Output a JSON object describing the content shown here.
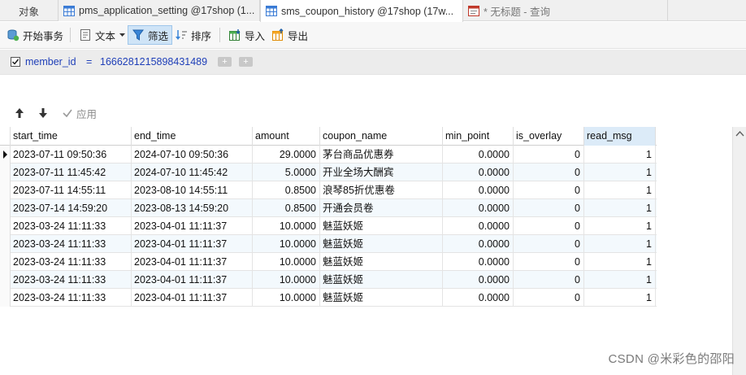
{
  "tabs": {
    "objects_label": "对象",
    "items": [
      {
        "label": "pms_application_setting @17shop (1..."
      },
      {
        "label": "sms_coupon_history @17shop (17w..."
      },
      {
        "label": "* 无标题 - 查询"
      }
    ]
  },
  "toolbar": {
    "begin_transaction": "开始事务",
    "text": "文本",
    "filter": "筛选",
    "sort": "排序",
    "import": "导入",
    "export": "导出"
  },
  "filter": {
    "field": "member_id",
    "operator": "=",
    "value": "1666281215898431489",
    "add_symbol": "+",
    "add_group_symbol": "+"
  },
  "nav": {
    "up_symbol": "🡑",
    "down_symbol": "🡓",
    "check_symbol": "✓",
    "apply": "应用"
  },
  "grid": {
    "columns": [
      "start_time",
      "end_time",
      "amount",
      "coupon_name",
      "min_point",
      "is_overlay",
      "read_msg"
    ],
    "rows": [
      [
        "2023-07-11 09:50:36",
        "2024-07-10 09:50:36",
        "29.0000",
        "茅台商品优惠券",
        "0.0000",
        "0",
        "1"
      ],
      [
        "2023-07-11 11:45:42",
        "2024-07-10 11:45:42",
        "5.0000",
        "开业全场大酬宾",
        "0.0000",
        "0",
        "1"
      ],
      [
        "2023-07-11 14:55:11",
        "2023-08-10 14:55:11",
        "0.8500",
        "浪琴85折优惠卷",
        "0.0000",
        "0",
        "1"
      ],
      [
        "2023-07-14 14:59:20",
        "2023-08-13 14:59:20",
        "0.8500",
        "开通会员卷",
        "0.0000",
        "0",
        "1"
      ],
      [
        "2023-03-24 11:11:33",
        "2023-04-01 11:11:37",
        "10.0000",
        "魅蓝妖姬",
        "0.0000",
        "0",
        "1"
      ],
      [
        "2023-03-24 11:11:33",
        "2023-04-01 11:11:37",
        "10.0000",
        "魅蓝妖姬",
        "0.0000",
        "0",
        "1"
      ],
      [
        "2023-03-24 11:11:33",
        "2023-04-01 11:11:37",
        "10.0000",
        "魅蓝妖姬",
        "0.0000",
        "0",
        "1"
      ],
      [
        "2023-03-24 11:11:33",
        "2023-04-01 11:11:37",
        "10.0000",
        "魅蓝妖姬",
        "0.0000",
        "0",
        "1"
      ],
      [
        "2023-03-24 11:11:33",
        "2023-04-01 11:11:37",
        "10.0000",
        "魅蓝妖姬",
        "0.0000",
        "0",
        "1"
      ]
    ],
    "selected_column": "read_msg",
    "current_row_index": 0
  },
  "watermark": "CSDN @米彩色的邵阳",
  "colors": {
    "filter_text": "#1f3fb8",
    "selection": "#cfe4f7",
    "alt_row": "#f3f9fd"
  },
  "icons": [
    "table-icon",
    "query-icon",
    "transaction-icon",
    "text-icon",
    "filter-icon",
    "sort-icon",
    "import-icon",
    "export-icon"
  ]
}
